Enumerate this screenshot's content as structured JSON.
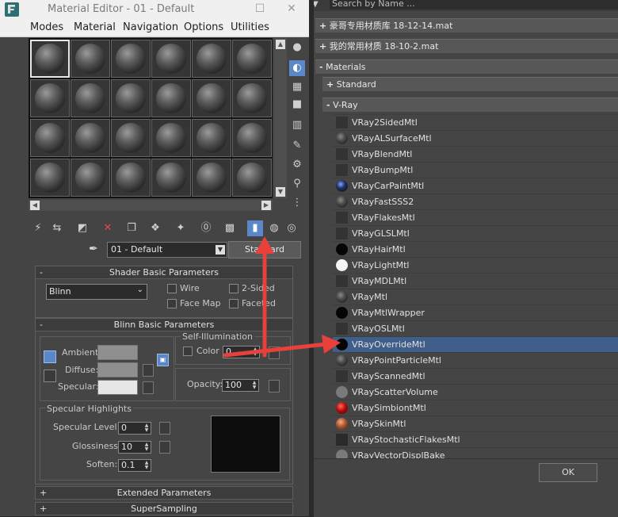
{
  "editor": {
    "title": "Material Editor - 01 - Default",
    "menu": [
      "Modes",
      "Material",
      "Navigation",
      "Options",
      "Utilities"
    ],
    "material_name": "01 - Default",
    "material_type": "Standard",
    "shader_rollout": {
      "title": "Shader Basic Parameters",
      "shader": "Blinn",
      "wire": "Wire",
      "two_sided": "2-Sided",
      "face_map": "Face Map",
      "faceted": "Faceted"
    },
    "blinn_rollout": {
      "title": "Blinn Basic Parameters",
      "ambient": "Ambient:",
      "diffuse": "Diffuse:",
      "specular": "Specular:",
      "self_illum_title": "Self-Illumination",
      "color_label": "Color",
      "color_value": "0",
      "opacity_label": "Opacity:",
      "opacity_value": "100",
      "spec_title": "Specular Highlights",
      "spec_level_label": "Specular Level:",
      "spec_level_value": "0",
      "glossiness_label": "Glossiness:",
      "glossiness_value": "10",
      "soften_label": "Soften:",
      "soften_value": "0.1"
    },
    "extended_rollout": "Extended Parameters",
    "supersampling_rollout": "SuperSampling",
    "colors": {
      "ambient": "#8f8f8f",
      "diffuse": "#8f8f8f",
      "specular": "#e6e6e6",
      "active_tool": "#5b86c7"
    }
  },
  "browser": {
    "search_placeholder": "Search by Name ...",
    "libraries": [
      {
        "prefix": "+",
        "label": "豪哥专用材质库 18-12-14.mat"
      },
      {
        "prefix": "+",
        "label": "我的常用材质     18-10-2.mat"
      }
    ],
    "materials_group": {
      "prefix": "-",
      "label": "Materials"
    },
    "standard_group": {
      "prefix": "+",
      "label": "Standard"
    },
    "vray_group": {
      "prefix": "-",
      "label": "V-Ray"
    },
    "vray_items": [
      "VRay2SidedMtl",
      "VRayALSurfaceMtl",
      "VRayBlendMtl",
      "VRayBumpMtl",
      "VRayCarPaintMtl",
      "VRayFastSSS2",
      "VRayFlakesMtl",
      "VRayGLSLMtl",
      "VRayHairMtl",
      "VRayLightMtl",
      "VRayMDLMtl",
      "VRayMtl",
      "VRayMtlWrapper",
      "VRayOSLMtl",
      "VRayOverrideMtl",
      "VRayPointParticleMtl",
      "VRayScannedMtl",
      "VRayScatterVolume",
      "VRaySimbiontMtl",
      "VRaySkinMtl",
      "VRayStochasticFlakesMtl",
      "VRayVectorDisplBake"
    ],
    "highlighted_item": "VRayOverrideMtl",
    "ok_label": "OK",
    "highlight_color": "#3f5f8a",
    "annotation_color": "#e8403a"
  }
}
